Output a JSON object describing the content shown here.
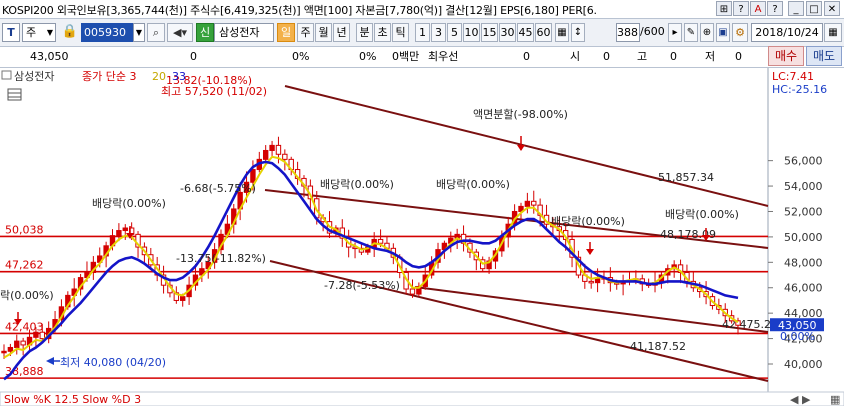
{
  "window": {
    "info_bar": "KOSPI200 외국인보유[3,365,744(천)] 주식수[6,419,325(천)] 액면[100] 자본금[7,780(억)] 결산[12월] EPS[6,180] PER[6.",
    "buttons": [
      "⊞",
      "?",
      "A",
      "?",
      "_",
      "□",
      "✕"
    ]
  },
  "toolbar": {
    "code_icon": "T",
    "mode": "주",
    "code": "005930",
    "stock_name": "삼성전자",
    "period_tabs": [
      "일",
      "주",
      "월",
      "년",
      "분",
      "초",
      "틱"
    ],
    "active_period": "일",
    "intervals": [
      "1",
      "3",
      "5",
      "10",
      "15",
      "30",
      "45",
      "60"
    ],
    "count": "388",
    "count_total": "/600",
    "date": "2018/10/24"
  },
  "quote": {
    "price": "43,050",
    "items": [
      "0",
      "0%",
      "0%",
      "0백만",
      "최우선",
      "0",
      "시",
      "0",
      "고",
      "0",
      "저",
      "0"
    ],
    "buy": "매수",
    "sell": "매도"
  },
  "chart_panel": {
    "name": "삼성전자",
    "indicator": "종가 단순 3",
    "ma20": "20",
    "ma33": "33",
    "lc": "LC:7.41",
    "hc": "HC:-25.16",
    "bottom_indicator": "Slow %K 12.5  Slow %D 3"
  },
  "colors": {
    "up": "#d40000",
    "ma_fast": "#e6d200",
    "ma_slow": "#1414c8",
    "hline": "#d40000",
    "trend": "#7a1010",
    "annot": "#222222"
  },
  "chart_data": {
    "type": "line",
    "title": "",
    "ylim": [
      39000,
      58000
    ],
    "y_ticks": [
      40000,
      42000,
      44000,
      46000,
      48000,
      50000,
      52000,
      54000,
      56000
    ],
    "y_tick_labels": [
      "40,000",
      "42,000",
      "44,000",
      "46,000",
      "48,000",
      "50,000",
      "52,000",
      "54,000",
      "56,000"
    ],
    "last_price": 43050,
    "last_price_label": "43,050",
    "last_pct_label": "0.00%",
    "hlines": [
      {
        "value": 50038,
        "label": "50,038"
      },
      {
        "value": 47262,
        "label": "47,262"
      },
      {
        "value": 42403,
        "label": "42,403"
      },
      {
        "value": 38888,
        "label": "38,888"
      }
    ],
    "price_close": [
      41000,
      41300,
      41800,
      41500,
      42100,
      42500,
      42000,
      42800,
      43500,
      44500,
      45400,
      45900,
      46800,
      47200,
      48000,
      48500,
      49300,
      50100,
      50500,
      50700,
      50200,
      49200,
      48600,
      47800,
      47000,
      46200,
      45600,
      45000,
      45300,
      46200,
      47000,
      47500,
      48000,
      49000,
      50200,
      51000,
      52200,
      53500,
      54300,
      55300,
      56100,
      56800,
      57200,
      56500,
      56100,
      55300,
      54600,
      54000,
      53000,
      51500,
      51200,
      50300,
      50700,
      49900,
      49200,
      49100,
      48800,
      49200,
      49800,
      49500,
      49100,
      48400,
      47200,
      45900,
      45500,
      46100,
      47000,
      48000,
      49000,
      49500,
      49900,
      50200,
      49500,
      48800,
      48200,
      47500,
      48100,
      48900,
      50000,
      51000,
      52000,
      52400,
      52800,
      52500,
      51700,
      51000,
      50800,
      50500,
      49800,
      48400,
      47000,
      46500,
      46400,
      46800,
      46800,
      46400,
      46300,
      46500,
      46600,
      46700,
      46300,
      46200,
      46400,
      47000,
      47500,
      47800,
      47200,
      46500,
      46000,
      45700,
      45300,
      44600,
      44300,
      43800,
      43400,
      43050
    ],
    "ma_fast": [
      40500,
      40800,
      41200,
      41100,
      41500,
      41900,
      41800,
      42300,
      42900,
      43700,
      44600,
      45300,
      46100,
      46700,
      47400,
      47900,
      48600,
      49300,
      49800,
      50100,
      50000,
      49400,
      48900,
      48200,
      47500,
      46800,
      46100,
      45500,
      45400,
      45800,
      46400,
      46900,
      47400,
      48200,
      49300,
      50100,
      51100,
      52200,
      53100,
      54000,
      54900,
      55700,
      56300,
      56200,
      55900,
      55300,
      54700,
      54100,
      53300,
      52100,
      51500,
      50800,
      50600,
      50100,
      49500,
      49300,
      49000,
      49100,
      49500,
      49400,
      49100,
      48600,
      47700,
      46700,
      46000,
      46000,
      46500,
      47300,
      48200,
      48900,
      49500,
      49900,
      49600,
      49000,
      48500,
      47900,
      48000,
      48600,
      49500,
      50500,
      51400,
      51900,
      52300,
      52300,
      51800,
      51200,
      50900,
      50600,
      50000,
      49000,
      47800,
      47000,
      46700,
      46800,
      46800,
      46500,
      46400,
      46500,
      46600,
      46700,
      46400,
      46300,
      46400,
      46800,
      47300,
      47600,
      47300,
      46700,
      46200,
      45900,
      45500,
      44900,
      44500,
      44000,
      43600,
      43300
    ],
    "ma_slow": [
      38800,
      39200,
      39900,
      40500,
      41000,
      41300,
      41700,
      42200,
      42700,
      43200,
      43800,
      44300,
      44800,
      45400,
      46000,
      46600,
      47200,
      47700,
      48100,
      48300,
      48400,
      48200,
      47900,
      47500,
      47100,
      46800,
      46600,
      46600,
      46800,
      47200,
      47700,
      48400,
      49200,
      50100,
      51100,
      52100,
      53100,
      54100,
      54900,
      55500,
      55800,
      55900,
      55800,
      55400,
      54900,
      54200,
      53500,
      52800,
      52100,
      51400,
      50900,
      50500,
      50300,
      50100,
      49900,
      49700,
      49500,
      49300,
      49100,
      49000,
      48900,
      48700,
      48400,
      48000,
      47700,
      47600,
      47700,
      48000,
      48400,
      48900,
      49300,
      49600,
      49700,
      49700,
      49600,
      49500,
      49500,
      49700,
      50100,
      50500,
      50900,
      51200,
      51400,
      51400,
      51100,
      50600,
      50100,
      49600,
      49200,
      48700,
      48200,
      47700,
      47300,
      47000,
      46800,
      46600,
      46500,
      46500,
      46500,
      46500,
      46400,
      46300,
      46300,
      46400,
      46500,
      46500,
      46500,
      46400,
      46300,
      46200,
      46000,
      45800,
      45600,
      45400,
      45300,
      45200
    ],
    "trendlines": [
      {
        "label": "51,857.34"
      },
      {
        "label": "41,187.52"
      },
      {
        "label": "48,178.09"
      },
      {
        "label": "42,475.2"
      }
    ],
    "annotations": [
      {
        "text": "최고 57,520 (11/02)"
      },
      {
        "text": "13.82(-10.18%)"
      },
      {
        "text": "액면분할(-98.00%)"
      },
      {
        "text": "-6.68(-5.75%)"
      },
      {
        "text": "배당락(0.00%)"
      },
      {
        "text": "배당락(0.00%)"
      },
      {
        "text": "배당락(0.00%)"
      },
      {
        "text": "배당락(0.00%)"
      },
      {
        "text": "배당락(0.00%)"
      },
      {
        "text": "-13.75(-11.82%)"
      },
      {
        "text": "-7.28(-5.53%)"
      },
      {
        "text": "락(0.00%)"
      },
      {
        "text": "최저 40,080 (04/20)"
      }
    ]
  }
}
